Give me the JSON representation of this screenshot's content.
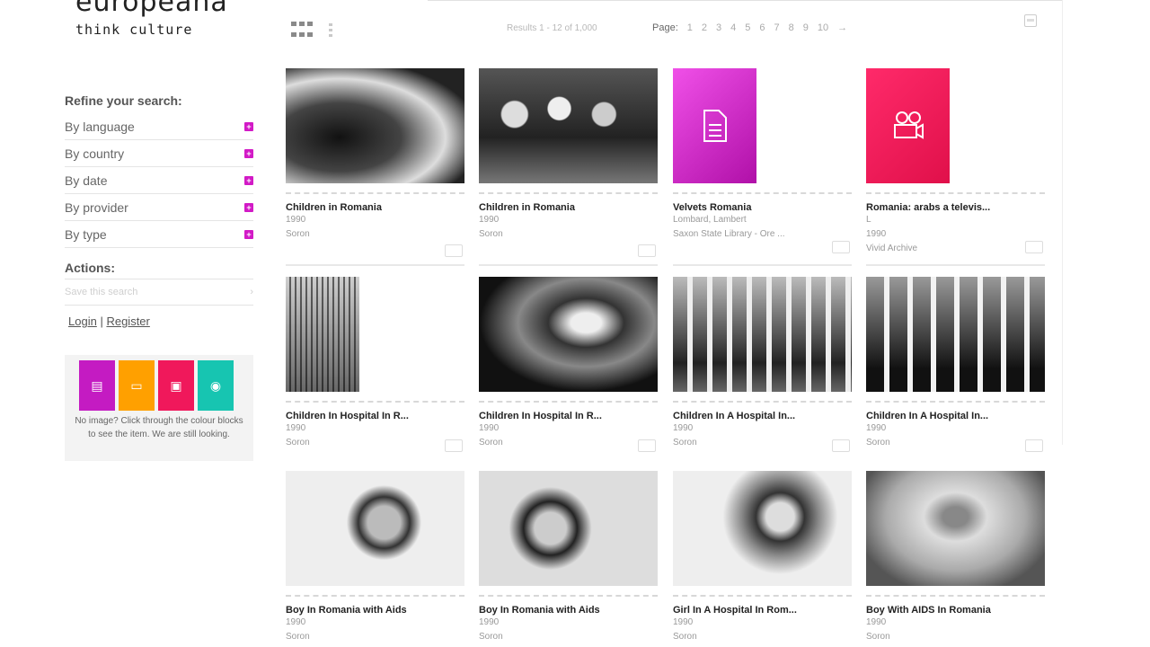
{
  "header": {
    "logo_word": "europeana",
    "tagline": "think culture"
  },
  "toolbar": {
    "results_text": "Results 1 - 12 of 1,000",
    "page_label": "Page:",
    "pages": [
      "1",
      "2",
      "3",
      "4",
      "5",
      "6",
      "7",
      "8",
      "9",
      "10",
      "→"
    ]
  },
  "sidebar": {
    "refine_title": "Refine your search:",
    "facets": [
      {
        "label": "By language"
      },
      {
        "label": "By country"
      },
      {
        "label": "By date"
      },
      {
        "label": "By provider"
      },
      {
        "label": "By type"
      }
    ],
    "actions_title": "Actions:",
    "save_search_placeholder": "Save this search",
    "login_label": "Login",
    "separator": "|",
    "register_label": "Register",
    "legend_text": "No image? Click through the colour blocks to see the item. We are still looking.",
    "legend_colors": [
      "#c41bc2",
      "#ffa000",
      "#f0185b",
      "#17c5b1"
    ]
  },
  "results": [
    {
      "title": "Children in Romania",
      "meta1": "1990",
      "meta2": "Soron",
      "type": "image"
    },
    {
      "title": "Children in Romania",
      "meta1": "1990",
      "meta2": "Soron",
      "type": "image"
    },
    {
      "title": "Velvets Romania",
      "meta1": "Lombard, Lambert",
      "meta2": "Saxon State Library - Ore ...",
      "type": "text",
      "tile_color": "#d21ac6"
    },
    {
      "title": "Romania: arabs a televis...",
      "meta1": "L",
      "meta2": "1990",
      "meta3": "Vivid Archive",
      "type": "video",
      "tile_color": "#f01a55"
    },
    {
      "title": "Children In Hospital In R...",
      "meta1": "1990",
      "meta2": "Soron",
      "type": "image"
    },
    {
      "title": "Children In Hospital In R...",
      "meta1": "1990",
      "meta2": "Soron",
      "type": "image"
    },
    {
      "title": "Children In A Hospital In...",
      "meta1": "1990",
      "meta2": "Soron",
      "type": "image"
    },
    {
      "title": "Children In A Hospital In...",
      "meta1": "1990",
      "meta2": "Soron",
      "type": "image"
    },
    {
      "title": "Boy In Romania with Aids",
      "meta1": "1990",
      "meta2": "Soron",
      "type": "image"
    },
    {
      "title": "Boy In Romania with Aids",
      "meta1": "1990",
      "meta2": "Soron",
      "type": "image"
    },
    {
      "title": "Girl In A Hospital In Rom...",
      "meta1": "1990",
      "meta2": "Soron",
      "type": "image"
    },
    {
      "title": "Boy With AIDS In Romania",
      "meta1": "1990",
      "meta2": "Soron",
      "type": "image"
    }
  ]
}
